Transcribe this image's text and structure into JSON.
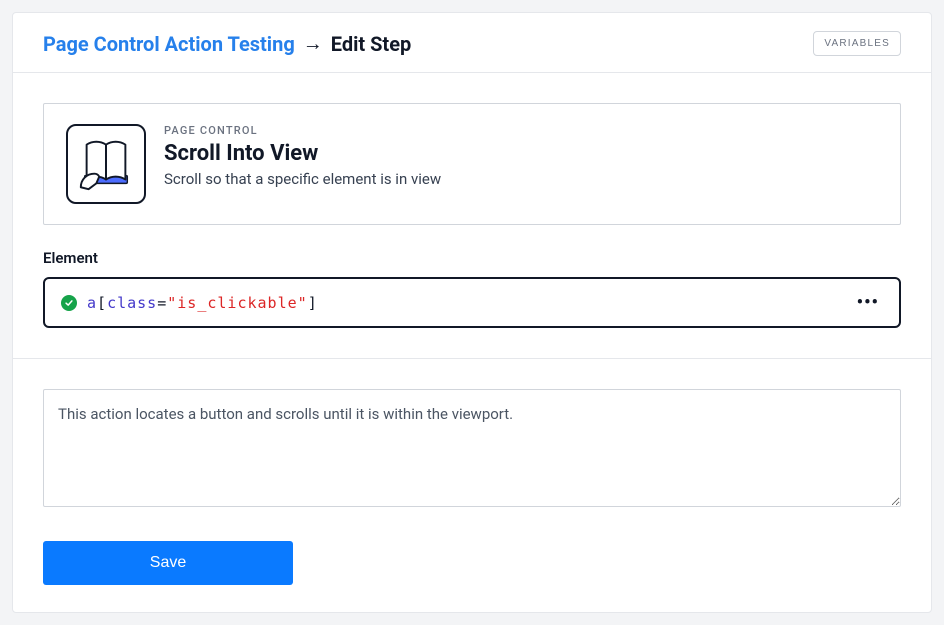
{
  "breadcrumb": {
    "parent": "Page Control Action Testing",
    "arrow": "→",
    "current": "Edit Step"
  },
  "header": {
    "variables_button": "VARIABLES"
  },
  "action": {
    "category": "PAGE CONTROL",
    "title": "Scroll Into View",
    "description": "Scroll so that a specific element is in view"
  },
  "element_field": {
    "label": "Element",
    "selector": {
      "tag": "a",
      "open": "[",
      "attr": "class",
      "eq": "=",
      "val": "\"is_clickable\"",
      "close": "]"
    }
  },
  "description_value": "This action locates a button and scrolls until it is within the viewport.",
  "save_label": "Save"
}
